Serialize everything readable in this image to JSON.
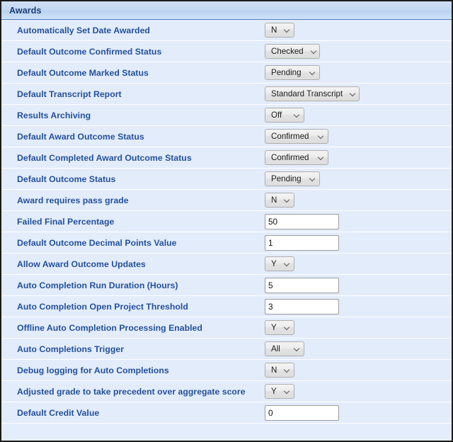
{
  "header": {
    "title": "Awards"
  },
  "icons": {
    "chevron_down": "chevron-down-icon"
  },
  "rows": [
    {
      "label": "Automatically Set Date Awarded",
      "type": "select",
      "value": "N",
      "width": "w-xs"
    },
    {
      "label": "Default Outcome Confirmed Status",
      "type": "select",
      "value": "Checked",
      "width": "w-md"
    },
    {
      "label": "Default Outcome Marked Status",
      "type": "select",
      "value": "Pending",
      "width": "w-md"
    },
    {
      "label": "Default Transcript Report",
      "type": "select",
      "value": "Standard Transcript",
      "width": "w-xl"
    },
    {
      "label": "Results Archiving",
      "type": "select",
      "value": "Off",
      "width": "w-sm"
    },
    {
      "label": "Default Award Outcome Status",
      "type": "select",
      "value": "Confirmed",
      "width": "w-lg"
    },
    {
      "label": "Default Completed Award Outcome Status",
      "type": "select",
      "value": "Confirmed",
      "width": "w-lg"
    },
    {
      "label": "Default Outcome Status",
      "type": "select",
      "value": "Pending",
      "width": "w-md"
    },
    {
      "label": "Award requires pass grade",
      "type": "select",
      "value": "N",
      "width": "w-xs"
    },
    {
      "label": "Failed Final Percentage",
      "type": "text",
      "value": "50"
    },
    {
      "label": "Default Outcome Decimal Points Value",
      "type": "text",
      "value": "1"
    },
    {
      "label": "Allow Award Outcome Updates",
      "type": "select",
      "value": "Y",
      "width": "w-xs"
    },
    {
      "label": "Auto Completion Run Duration (Hours)",
      "type": "text",
      "value": "5"
    },
    {
      "label": "Auto Completion Open Project Threshold",
      "type": "text",
      "value": "3"
    },
    {
      "label": "Offline Auto Completion Processing Enabled",
      "type": "select",
      "value": "Y",
      "width": "w-xs"
    },
    {
      "label": "Auto Completions Trigger",
      "type": "select",
      "value": "All",
      "width": "w-sm"
    },
    {
      "label": "Debug logging for Auto Completions",
      "type": "select",
      "value": "N",
      "width": "w-xs"
    },
    {
      "label": "Adjusted grade to take precedent over aggregate score",
      "type": "select",
      "value": "Y",
      "width": "w-xs"
    },
    {
      "label": "Default Credit Value",
      "type": "text",
      "value": "0"
    }
  ]
}
